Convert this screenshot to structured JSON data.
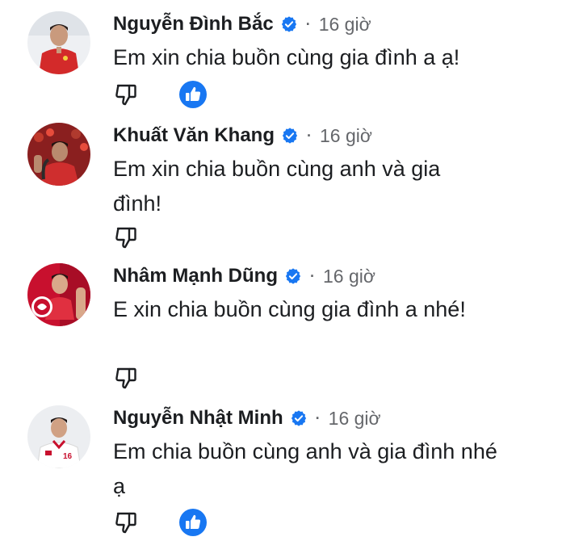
{
  "comments": [
    {
      "name": "Nguyễn Đình Bắc",
      "verified": true,
      "separator": "·",
      "time": "16 giờ",
      "text": "Em xin chia buồn cùng gia đình a ạ!",
      "has_like_reaction": true,
      "avatar_icon": "player-avatar-red-jersey"
    },
    {
      "name": "Khuất Văn Khang",
      "verified": true,
      "separator": "·",
      "time": "16 giờ",
      "text": "Em xin chia buồn cùng anh và gia đình!",
      "has_like_reaction": false,
      "avatar_icon": "player-avatar-crowd"
    },
    {
      "name": "Nhâm Mạnh Dũng",
      "verified": true,
      "separator": "·",
      "time": "16 giờ",
      "text": "E xin chia buồn cùng gia đình a nhé!",
      "has_like_reaction": false,
      "avatar_icon": "player-avatar-red-logo"
    },
    {
      "name": "Nguyễn Nhật Minh",
      "verified": true,
      "separator": "·",
      "time": "16 giờ",
      "text": "Em chia buồn cùng anh và gia đình nhé ạ",
      "has_like_reaction": true,
      "avatar_icon": "player-avatar-white-jersey"
    }
  ],
  "colors": {
    "verified_blue": "#1877f2",
    "like_blue": "#1877f2",
    "secondary_text": "#65676b"
  }
}
